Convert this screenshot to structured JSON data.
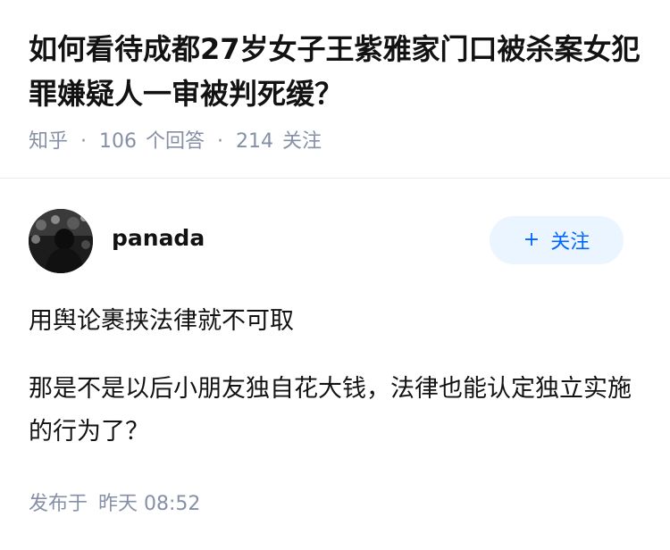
{
  "question": {
    "title": "如何看待成都27岁女子王紫雅家门口被杀案女犯罪嫌疑人一审被判死缓？",
    "source": "知乎",
    "answer_count": "106",
    "answer_label": "个回答",
    "follower_count": "214",
    "follower_label": "关注"
  },
  "answer": {
    "author": "panada",
    "follow_label": "关注",
    "paragraphs": [
      "用舆论裹挟法律就不可取",
      "那是不是以后小朋友独自花大钱，法律也能认定独立实施的行为了？"
    ],
    "publish_prefix": "发布于",
    "publish_time": "昨天 08:52"
  },
  "icons": {
    "follow": "plus-icon",
    "avatar": "avatar-image"
  },
  "colors": {
    "accent": "#0066ff",
    "button_bg": "#ebf5ff",
    "meta_text": "#8590a6",
    "primary_text": "#121212"
  }
}
